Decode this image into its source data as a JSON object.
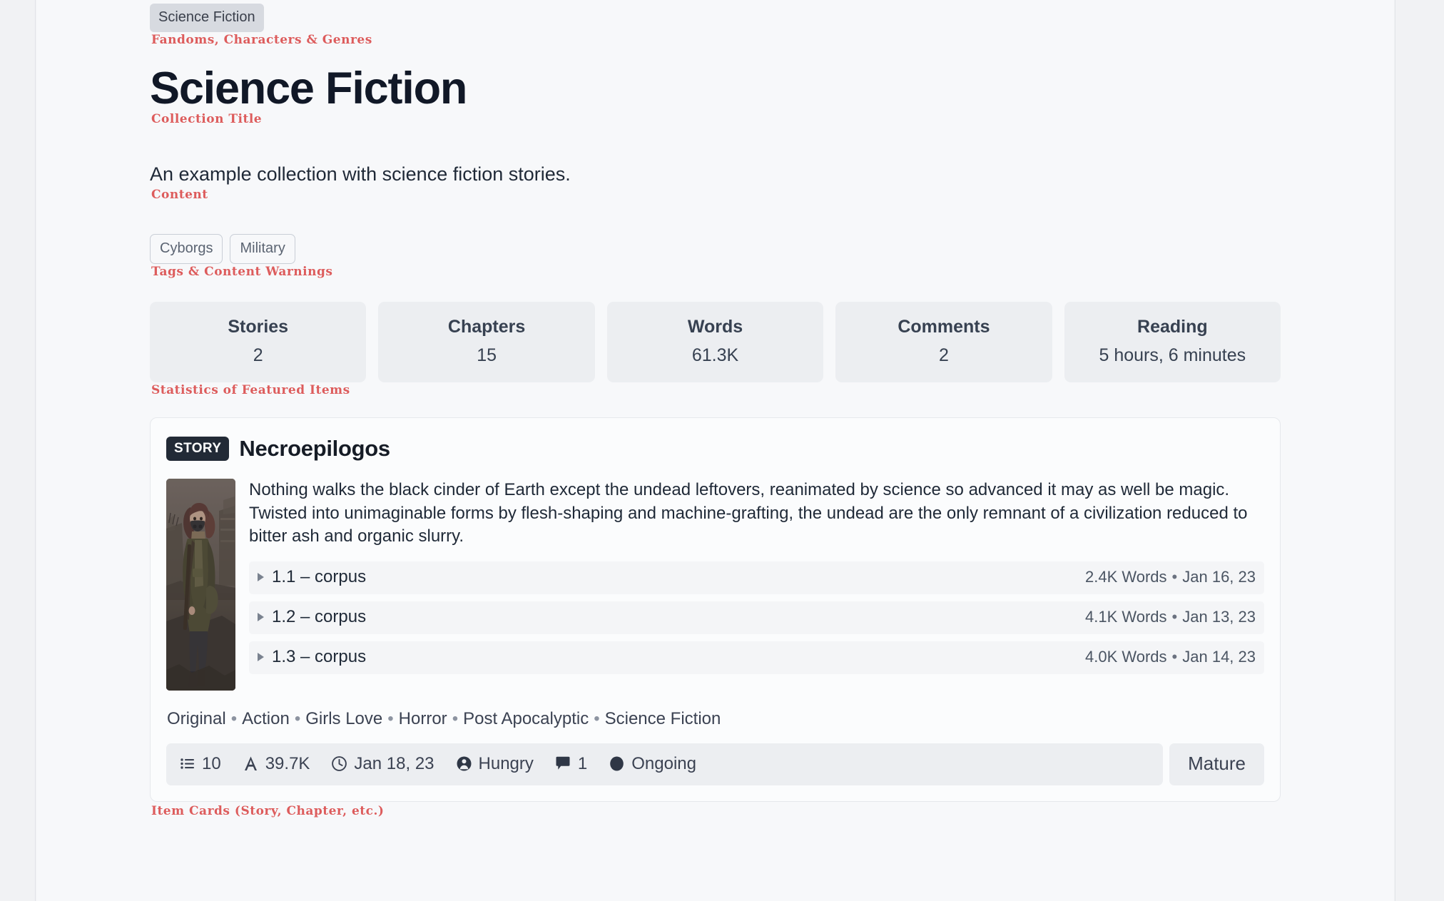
{
  "annotations": {
    "fandoms": "Fandoms, Characters & Genres",
    "collection_title": "Collection Title",
    "content": "Content",
    "tags": "Tags & Content Warnings",
    "statistics": "Statistics of Featured Items",
    "item_cards": "Item Cards (Story, Chapter, etc.)"
  },
  "colors": {
    "annotation_red": "#dd5c5c",
    "page_background": "#f7f8fa",
    "gutter": "#f1f2f4",
    "badge_dark": "#222a36",
    "chip_grey": "#d7dae0",
    "stat_box": "#eceef1"
  },
  "fandom_chips": [
    {
      "label": "Science Fiction"
    }
  ],
  "collection": {
    "title": "Science Fiction",
    "description": "An example collection with science fiction stories."
  },
  "tags": [
    {
      "label": "Cyborgs"
    },
    {
      "label": "Military"
    }
  ],
  "stats": [
    {
      "label": "Stories",
      "value": "2"
    },
    {
      "label": "Chapters",
      "value": "15"
    },
    {
      "label": "Words",
      "value": "61.3K"
    },
    {
      "label": "Comments",
      "value": "2"
    },
    {
      "label": "Reading",
      "value": "5 hours, 6 minutes"
    }
  ],
  "item_card": {
    "kind_badge": "STORY",
    "title": "Necroepilogos",
    "cover_alt": "masked woman with rifle walking through ruined city",
    "synopsis": "Nothing walks the black cinder of Earth except the undead leftovers, reanimated by science so advanced it may as well be magic. Twisted into unimaginable forms by flesh-shaping and machine-grafting, the undead are the only remnant of a civilization reduced to bitter ash and organic slurry.",
    "chapters": [
      {
        "name": "1.1 – corpus",
        "words": "2.4K Words",
        "separator": "•",
        "date": "Jan 16, 23"
      },
      {
        "name": "1.2 – corpus",
        "words": "4.1K Words",
        "separator": "•",
        "date": "Jan 13, 23"
      },
      {
        "name": "1.3 – corpus",
        "words": "4.0K Words",
        "separator": "•",
        "date": "Jan 14, 23"
      }
    ],
    "genres": [
      "Original",
      "Action",
      "Girls Love",
      "Horror",
      "Post Apocalyptic",
      "Science Fiction"
    ],
    "genre_separator": "•",
    "footer_stats": [
      {
        "icon": "list-icon",
        "value": "10"
      },
      {
        "icon": "letter-a-icon",
        "value": "39.7K"
      },
      {
        "icon": "clock-icon",
        "value": "Jan 18, 23"
      },
      {
        "icon": "user-icon",
        "value": "Hungry"
      },
      {
        "icon": "comment-icon",
        "value": "1"
      },
      {
        "icon": "circle-status-icon",
        "value": "Ongoing"
      }
    ],
    "rating": "Mature"
  }
}
